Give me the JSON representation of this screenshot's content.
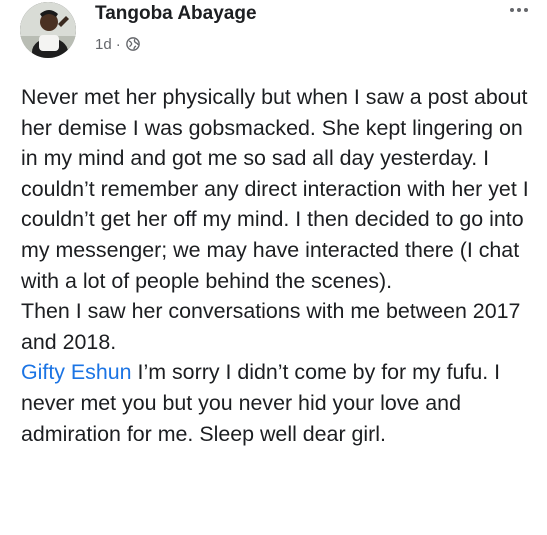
{
  "post": {
    "author": "Tangoba Abayage",
    "timestamp": "1d",
    "separator": "·",
    "privacy_icon": "globe-icon",
    "menu_icon": "more-options-icon",
    "paragraph1": "Never met her physically but when I saw a post about her demise I was gobsmacked. She kept lingering on in my mind and got me so sad all day yesterday. I couldn’t remember any direct interaction with her yet I couldn’t get her off my mind. I then decided to go into my messenger; we may have interacted there (I chat with a lot of people behind the scenes).",
    "paragraph2": "Then I saw her conversations with me between 2017 and 2018.",
    "mention": "Gifty Eshun",
    "paragraph3": " I’m sorry I didn’t come by for my fufu. I never met you but you never hid your love and admiration for me. Sleep well dear girl."
  },
  "colors": {
    "mention": "#1b74e4",
    "text": "#1c1e21",
    "meta": "#65676b"
  }
}
